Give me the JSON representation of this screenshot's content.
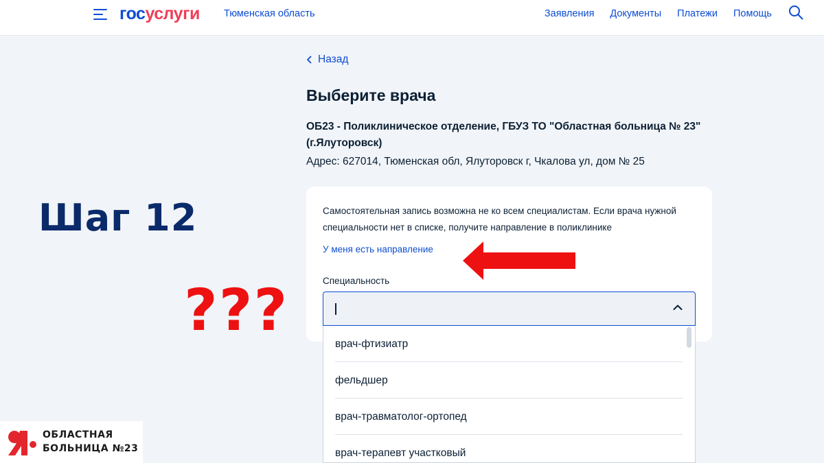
{
  "header": {
    "logo_part1": "гос",
    "logo_part2": "услуги",
    "region": "Тюменская область",
    "nav": [
      "Заявления",
      "Документы",
      "Платежи",
      "Помощь"
    ],
    "icons": [
      "menu-icon",
      "search-icon"
    ]
  },
  "main": {
    "back_label": "Назад",
    "title": "Выберите врача",
    "org_name": "ОБ23 - Поликлиническое отделение, ГБУЗ ТО \"Областная больница № 23\" (г.Ялуторовск)",
    "address": "Адрес: 627014, Тюменская обл, Ялуторовск г, Чкалова ул, дом № 25",
    "info": "Самостоятельная запись возможна не ко всем специалистам. Если врача нужной специальности нет в списке, получите направление в поликлинике",
    "referral_link": "У меня есть направление",
    "specialty_label": "Специальность",
    "specialty_value": "",
    "options": [
      "врач-фтизиатр",
      "фельдшер",
      "врач-травматолог-ортопед",
      "врач-терапевт участковый"
    ]
  },
  "overlay": {
    "step": "Шаг 12",
    "question": "???",
    "arrow_color": "#ee1111"
  },
  "badge": {
    "line1": "ОБЛАСТНАЯ",
    "line2": "БОЛЬНИЦА №23"
  },
  "colors": {
    "accent": "#0d4cd3",
    "brand_red": "#ee3f58",
    "text": "#0b1f33",
    "background": "#f1f4f8"
  }
}
